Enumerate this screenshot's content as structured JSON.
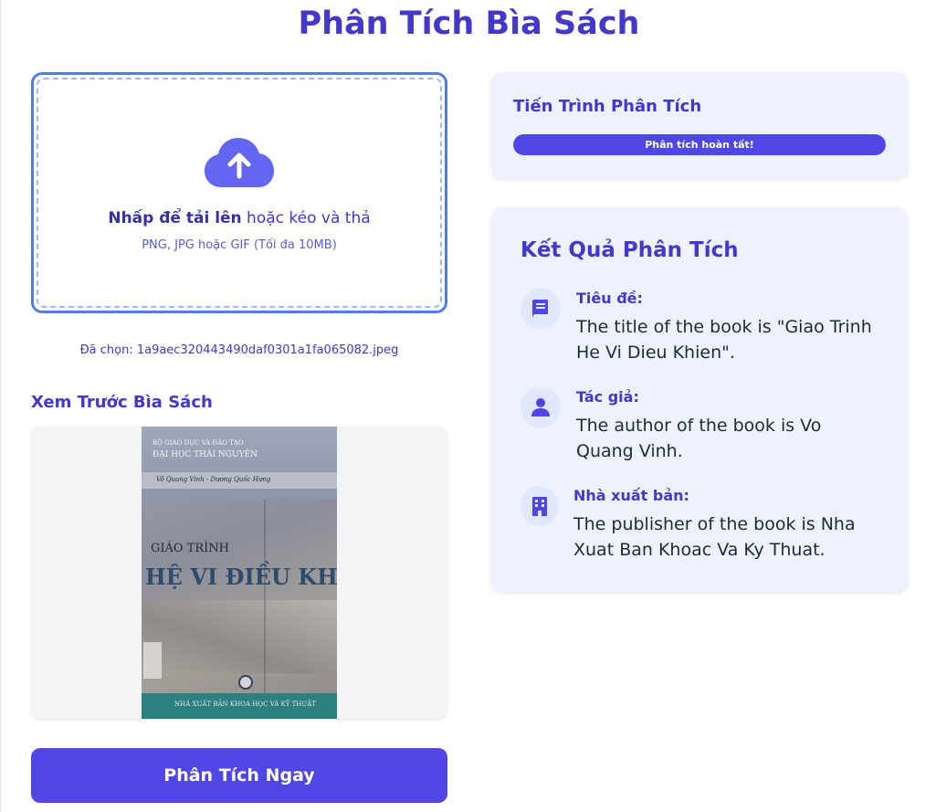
{
  "page": {
    "title": "Phân Tích Bìa Sách"
  },
  "upload": {
    "prompt_bold": "Nhấp để tải lên",
    "prompt_rest": " hoặc kéo và thả",
    "hint": "PNG, JPG hoặc GIF (Tối đa 10MB)",
    "selected_file": "Đã chọn: 1a9aec320443490daf0301a1fa065082.jpeg",
    "icon": "cloud-upload-icon"
  },
  "preview": {
    "heading": "Xem Trước Bìa Sách",
    "cover": {
      "ministry": "BỘ GIÁO DỤC VÀ ĐÀO TẠO",
      "university": "ĐẠI HỌC THÁI NGUYÊN",
      "authors": "Võ Quang Vinh - Dương Quốc Hưng",
      "series": "GIÁO TRÌNH",
      "title": "HỆ VI ĐIỀU KHIỂN",
      "publisher": "NHÀ XUẤT BẢN KHOA HỌC VÀ KỸ THUẬT"
    }
  },
  "actions": {
    "analyze_label": "Phân Tích Ngay"
  },
  "progress": {
    "title": "Tiến Trình Phân Tích",
    "status": "Phân tích hoàn tất!",
    "percent": 100
  },
  "results": {
    "title": "Kết Quả Phân Tích",
    "items": [
      {
        "label": "Tiêu đề:",
        "value": "The title of the book is \"Giao Trinh He Vi Dieu Khien\".",
        "icon": "book-icon"
      },
      {
        "label": "Tác giả:",
        "value": "The author of the book is Vo Quang Vinh.",
        "icon": "user-icon"
      },
      {
        "label": "Nhà xuất bản:",
        "value": "The publisher of the book is Nha Xuat Ban Khoac Va Ky Thuat.",
        "icon": "building-icon"
      }
    ]
  },
  "colors": {
    "accent": "#4f46e5",
    "heading": "#4338ca",
    "card_bg": "#eef2ff",
    "dropzone_border": "#4f7fe6"
  }
}
